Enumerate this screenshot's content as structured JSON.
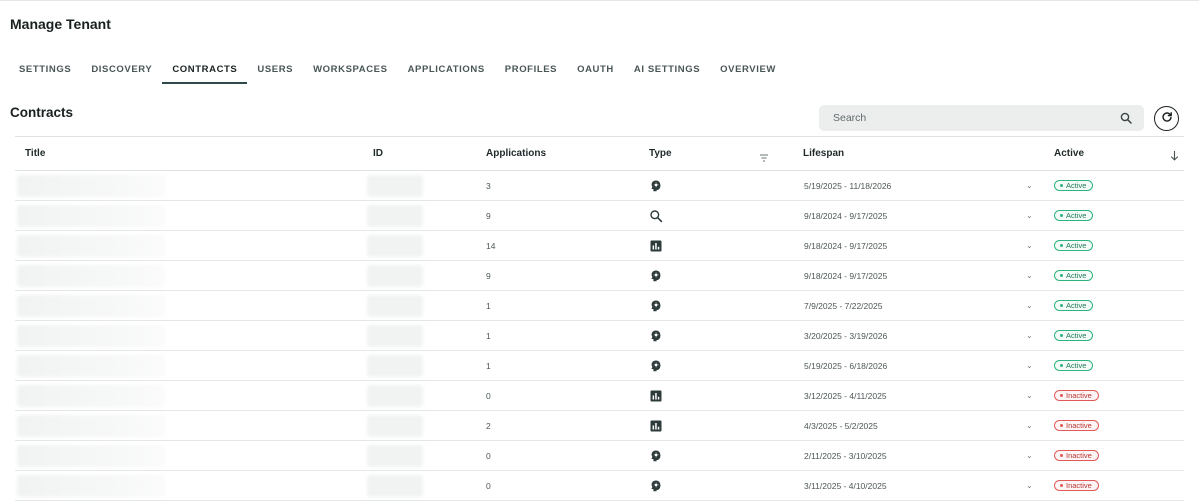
{
  "page_title": "Manage Tenant",
  "tabs": [
    {
      "label": "SETTINGS",
      "active": false
    },
    {
      "label": "DISCOVERY",
      "active": false
    },
    {
      "label": "CONTRACTS",
      "active": true
    },
    {
      "label": "USERS",
      "active": false
    },
    {
      "label": "WORKSPACES",
      "active": false
    },
    {
      "label": "APPLICATIONS",
      "active": false
    },
    {
      "label": "PROFILES",
      "active": false
    },
    {
      "label": "OAUTH",
      "active": false
    },
    {
      "label": "AI SETTINGS",
      "active": false
    },
    {
      "label": "OVERVIEW",
      "active": false
    }
  ],
  "section_title": "Contracts",
  "search": {
    "placeholder": "Search"
  },
  "table": {
    "columns": {
      "title": "Title",
      "id": "ID",
      "applications": "Applications",
      "type": "Type",
      "lifespan": "Lifespan",
      "active": "Active"
    },
    "rows": [
      {
        "applications": "3",
        "type_icon": "brain-icon",
        "lifespan": "5/19/2025 - 11/18/2026",
        "status": "Active"
      },
      {
        "applications": "9",
        "type_icon": "search-icon",
        "lifespan": "9/18/2024 - 9/17/2025",
        "status": "Active"
      },
      {
        "applications": "14",
        "type_icon": "bar-chart-icon",
        "lifespan": "9/18/2024 - 9/17/2025",
        "status": "Active"
      },
      {
        "applications": "9",
        "type_icon": "brain-icon",
        "lifespan": "9/18/2024 - 9/17/2025",
        "status": "Active"
      },
      {
        "applications": "1",
        "type_icon": "brain-icon",
        "lifespan": "7/9/2025 - 7/22/2025",
        "status": "Active"
      },
      {
        "applications": "1",
        "type_icon": "brain-icon",
        "lifespan": "3/20/2025 - 3/19/2026",
        "status": "Active"
      },
      {
        "applications": "1",
        "type_icon": "brain-icon",
        "lifespan": "5/19/2025 - 6/18/2026",
        "status": "Active"
      },
      {
        "applications": "0",
        "type_icon": "bar-chart-icon",
        "lifespan": "3/12/2025 - 4/11/2025",
        "status": "Inactive"
      },
      {
        "applications": "2",
        "type_icon": "bar-chart-icon",
        "lifespan": "4/3/2025 - 5/2/2025",
        "status": "Inactive"
      },
      {
        "applications": "0",
        "type_icon": "brain-icon",
        "lifespan": "2/11/2025 - 3/10/2025",
        "status": "Inactive"
      },
      {
        "applications": "0",
        "type_icon": "brain-icon",
        "lifespan": "3/11/2025 - 4/10/2025",
        "status": "Inactive"
      }
    ]
  },
  "colors": {
    "active_border": "#2db37d",
    "inactive_border": "#e05a5a",
    "tab_indicator": "#2f4a4a",
    "icon_dark": "#2e3b3b"
  }
}
